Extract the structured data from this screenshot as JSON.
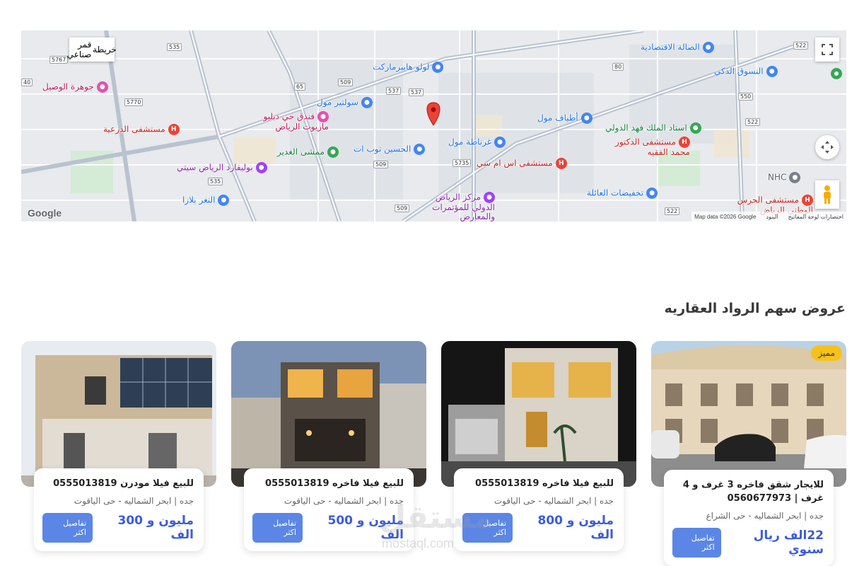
{
  "map": {
    "google_label": "Google",
    "attribution": [
      "Map data ©2026 Google",
      "البنود",
      "اختصارات لوحة المفاتيح"
    ],
    "map_type_tabs": [
      "قمر صناعي",
      "خريطة"
    ],
    "places": [
      {
        "name": "لولو هايبرماركت",
        "kind": "blue"
      },
      {
        "name": "الصالة الاقتصادية",
        "kind": "blue"
      },
      {
        "name": "النسوق الذكي",
        "kind": "blue"
      },
      {
        "name": "جوهرة الوصيل",
        "kind": "pink"
      },
      {
        "name": "سولتير مول",
        "kind": "blue"
      },
      {
        "name": "فندق حي دبليو ماريوت الرياض",
        "kind": "pink"
      },
      {
        "name": "أطياف مول",
        "kind": "blue"
      },
      {
        "name": "استاد الملك فهد الدولي",
        "kind": "green"
      },
      {
        "name": "مستشفى الدرعية",
        "kind": "red"
      },
      {
        "name": "غرناطة مول",
        "kind": "blue"
      },
      {
        "name": "الحسين توب ات",
        "kind": "blue"
      },
      {
        "name": "ممشى الغدير",
        "kind": "green"
      },
      {
        "name": "مستشفى الدكتور محمد الفقيه",
        "kind": "red"
      },
      {
        "name": "بوليفارد الرياض سيتي",
        "kind": "purple"
      },
      {
        "name": "مستشفى اس ام سي",
        "kind": "red"
      },
      {
        "name": "NHC",
        "kind": "grey"
      },
      {
        "name": "تخفيضات العائلة",
        "kind": "blue"
      },
      {
        "name": "النغر بلازا",
        "kind": "blue"
      },
      {
        "name": "مركز الرياض الدولي للمؤتمرات والمعارض",
        "kind": "purple"
      },
      {
        "name": "مستشفى الحرس الوطني الرياض",
        "kind": "red"
      }
    ],
    "shields": [
      "535",
      "537",
      "80",
      "522",
      "509",
      "537",
      "65",
      "550",
      "535",
      "5735",
      "509",
      "522",
      "509",
      "522",
      "5770",
      "5767",
      "40"
    ]
  },
  "section": {
    "title": "عروض سهم الرواد العقاريه"
  },
  "cards": [
    {
      "badge": "مميز",
      "title": "للايجار شقق فاخره 3 غرف و 4 غرف | 0560677973",
      "location": "جده | ابحر الشماليه - حى الشراع",
      "price": "22الف ريال سنوي",
      "button": "تفاصيل اكثر"
    },
    {
      "badge": "",
      "title": "للبيع فيلا فاخره 0555013819",
      "location": "جده | ابحر الشماليه - حى الياقوت",
      "price": "مليون و 800 الف",
      "button": "تفاصيل اكثر"
    },
    {
      "badge": "",
      "title": "للبيع فيلا فاخره 0555013819",
      "location": "جده | ابحر الشماليه - حى الياقوت",
      "price": "مليون و 500 الف",
      "button": "تفاصيل اكثر"
    },
    {
      "badge": "",
      "title": "للبيع فيلا مودرن 0555013819",
      "location": "جده | ابحر الشماليه - حى الياقوت",
      "price": "مليون و 300 الف",
      "button": "تفاصيل اكثر"
    }
  ],
  "watermark": {
    "arabic": "مستقل",
    "latin": "mostaql.com"
  },
  "colors": {
    "price": "#3b5bdb",
    "button": "#5b86e5",
    "badge": "#f6c21a"
  }
}
